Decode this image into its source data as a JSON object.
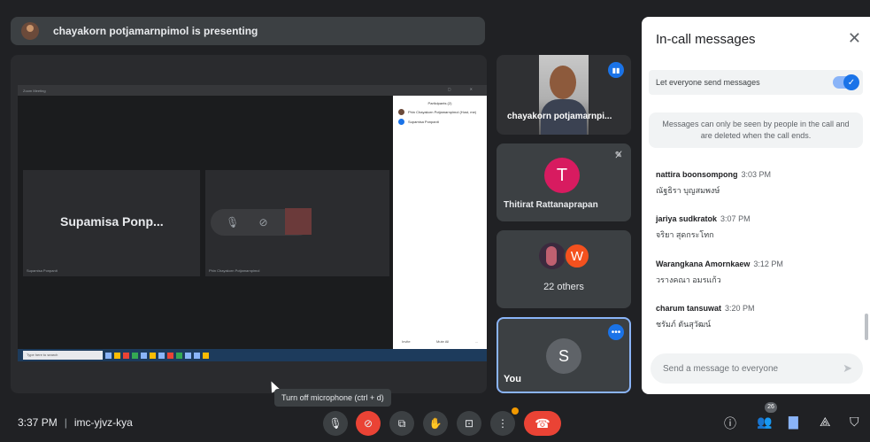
{
  "banner": {
    "text": "chayakorn potjamarnpimol is presenting"
  },
  "presentation": {
    "window_title": "Zoom Meeting",
    "tile_name": "Supamisa Ponp...",
    "tile_caption_left": "Supamisa Ponpanit",
    "tile_caption_right": "Phin Chayakorn Potjamarnpimol",
    "participants_header": "Participants (2)",
    "participants": [
      "Phin Chayakorn Potjamarnpimol (Host, me)",
      "Supamisa Ponpanit"
    ],
    "panel_buttons": [
      "Invite",
      "Mute All",
      "..."
    ],
    "taskbar_search": "Type here to search"
  },
  "tiles": [
    {
      "name": "chayakorn potjamarnpi..."
    },
    {
      "initial": "T",
      "name": "Thitirat Rattanaprapan",
      "color": "#d81b60"
    },
    {
      "initial": "W",
      "name": "22 others",
      "color": "#f4511e"
    },
    {
      "initial": "S",
      "name": "You",
      "color": "#5f6368"
    }
  ],
  "chat": {
    "title": "In-call messages",
    "toggle_label": "Let everyone send messages",
    "toggle_on": true,
    "notice": "Messages can only be seen by people in the call and are deleted when the call ends.",
    "messages": [
      {
        "sender": "nattira boonsompong",
        "time": "3:03 PM",
        "text": "ณัฐธิรา บุญสมพงษ์"
      },
      {
        "sender": "jariya sudkratok",
        "time": "3:07 PM",
        "text": "จริยา สุดกระโทก"
      },
      {
        "sender": "Warangkana Amornkaew",
        "time": "3:12 PM",
        "text": "วรางคณา อมรแก้ว"
      },
      {
        "sender": "charum tansuwat",
        "time": "3:20 PM",
        "text": "ชรัมภ์ ตันสุวัฒน์"
      }
    ],
    "input_placeholder": "Send a message to everyone"
  },
  "tooltip": "Turn off microphone (ctrl + d)",
  "bottom": {
    "time": "3:37 PM",
    "separator": "|",
    "meeting_code": "imc-yjvz-kya",
    "participant_count": "26"
  },
  "accent": "#1a73e8",
  "danger": "#ea4335"
}
